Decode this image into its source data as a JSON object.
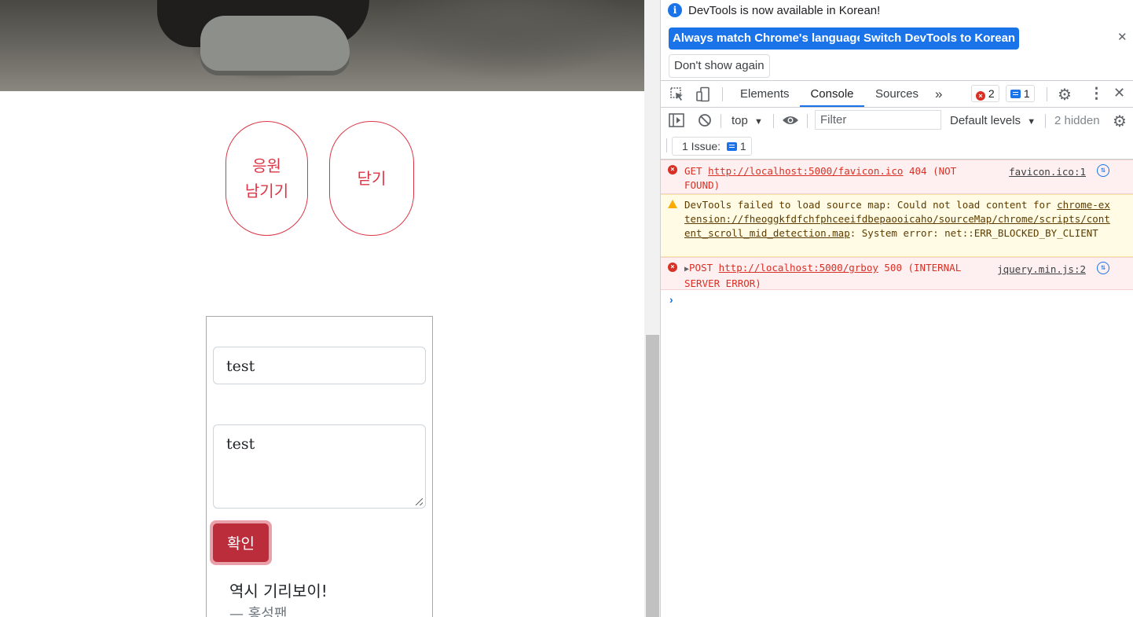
{
  "page": {
    "buttons": {
      "cheer": "응원 남기기",
      "close": "닫기"
    },
    "form": {
      "name_value": "test",
      "message_value": "test",
      "confirm_label": "확인"
    },
    "quote": {
      "text": "역시 기리보이!",
      "author": "— 홍성팬"
    }
  },
  "devtools": {
    "infobar": {
      "message": "DevTools is now available in Korean!",
      "match_button": "Always match Chrome's language",
      "switch_button": "Switch DevTools to Korean",
      "dont_show_button": "Don't show again"
    },
    "tabs": [
      "Elements",
      "Console",
      "Sources"
    ],
    "active_tab": "Console",
    "error_count": "2",
    "message_count": "1",
    "toolbar": {
      "context": "top",
      "filter_placeholder": "Filter",
      "levels": "Default levels",
      "hidden": "2 hidden"
    },
    "issues": {
      "label": "1 Issue:",
      "count": "1"
    },
    "logs": [
      {
        "level": "error",
        "prefix": "GET ",
        "url": "http://localhost:5000/favicon.ico",
        "suffix": " 404 (NOT FOUND)",
        "source": "favicon.ico:1"
      },
      {
        "level": "warning",
        "prefix": "DevTools failed to load source map: Could not load content for ",
        "url": "chrome-extension://fheoggkfdfchfphceeifdbepaooicaho/sourceMap/chrome/scripts/content_scroll_mid_detection.map",
        "suffix": ": System error: net::ERR_BLOCKED_BY_CLIENT",
        "source": ""
      },
      {
        "level": "error",
        "prefix": "POST ",
        "url": "http://localhost:5000/grboy",
        "suffix": " 500 (INTERNAL SERVER ERROR)",
        "source": "jquery.min.js:2"
      }
    ],
    "colors": {
      "accent": "#1a73e8",
      "error": "#d93025",
      "warning": "#f9ab00"
    }
  }
}
